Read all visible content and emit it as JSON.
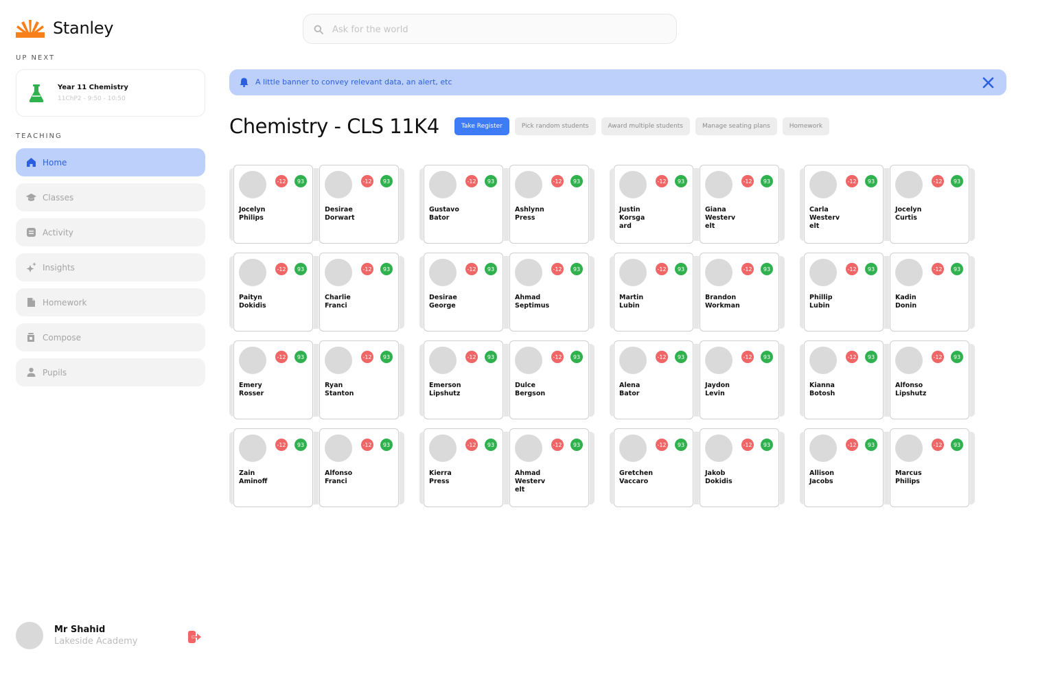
{
  "brand": {
    "name": "Stanley",
    "accent": "#f7801b"
  },
  "sidebar": {
    "up_next_label": "UP NEXT",
    "up_next": {
      "title": "Year 11 Chemistry",
      "subtitle": "11ChP2 - 9:50 - 10:50",
      "icon": "flask-icon"
    },
    "teaching_label": "TEACHING",
    "items": [
      {
        "label": "Home",
        "icon": "home-icon",
        "active": true
      },
      {
        "label": "Classes",
        "icon": "graduation-cap-icon",
        "active": false
      },
      {
        "label": "Activity",
        "icon": "list-icon",
        "active": false
      },
      {
        "label": "Insights",
        "icon": "sparkles-icon",
        "active": false
      },
      {
        "label": "Homework",
        "icon": "document-icon",
        "active": false
      },
      {
        "label": "Compose",
        "icon": "mug-icon",
        "active": false
      },
      {
        "label": "Pupils",
        "icon": "person-icon",
        "active": false
      }
    ],
    "profile": {
      "name": "Mr Shahid",
      "school": "Lakeside Academy"
    }
  },
  "search": {
    "placeholder": "Ask for the world",
    "value": ""
  },
  "banner": {
    "text": "A little banner to convey relevant data, an alert, etc"
  },
  "page": {
    "title": "Chemistry - CLS 11K4",
    "actions": {
      "take_register": "Take Register",
      "pick_random": "Pick random students",
      "award_multiple": "Award multiple students",
      "manage_seating": "Manage seating plans",
      "homework": "Homework"
    }
  },
  "colors": {
    "primary": "#3e7bf6",
    "banner_bg": "#bcd0fb",
    "negative": "#f06565",
    "positive": "#2fb14d"
  },
  "students": [
    {
      "name": "Jocelyn\nPhilips",
      "neg": "-12",
      "pos": "93"
    },
    {
      "name": "Desirae\nDorwart",
      "neg": "-12",
      "pos": "93"
    },
    {
      "name": "Gustavo\nBator",
      "neg": "-12",
      "pos": "93"
    },
    {
      "name": "Ashlynn\nPress",
      "neg": "-12",
      "pos": "93"
    },
    {
      "name": "Justin\nKorsga\nard",
      "neg": "-12",
      "pos": "93"
    },
    {
      "name": "Giana\nWesterv\nelt",
      "neg": "-12",
      "pos": "93"
    },
    {
      "name": "Carla\nWesterv\nelt",
      "neg": "-12",
      "pos": "93"
    },
    {
      "name": "Jocelyn\nCurtis",
      "neg": "-12",
      "pos": "93"
    },
    {
      "name": "Paityn\nDokidis",
      "neg": "-12",
      "pos": "93"
    },
    {
      "name": "Charlie\nFranci",
      "neg": "-12",
      "pos": "93"
    },
    {
      "name": "Desirae\nGeorge",
      "neg": "-12",
      "pos": "93"
    },
    {
      "name": "Ahmad\nSeptimus",
      "neg": "-12",
      "pos": "93"
    },
    {
      "name": "Martin\nLubin",
      "neg": "-12",
      "pos": "93"
    },
    {
      "name": "Brandon\nWorkman",
      "neg": "-12",
      "pos": "93"
    },
    {
      "name": "Phillip\nLubin",
      "neg": "-12",
      "pos": "93"
    },
    {
      "name": "Kadin\nDonin",
      "neg": "-12",
      "pos": "93"
    },
    {
      "name": "Emery\nRosser",
      "neg": "-12",
      "pos": "93"
    },
    {
      "name": "Ryan\nStanton",
      "neg": "-12",
      "pos": "93"
    },
    {
      "name": "Emerson\nLipshutz",
      "neg": "-12",
      "pos": "93"
    },
    {
      "name": "Dulce\nBergson",
      "neg": "-12",
      "pos": "93"
    },
    {
      "name": "Alena\nBator",
      "neg": "-12",
      "pos": "93"
    },
    {
      "name": "Jaydon\nLevin",
      "neg": "-12",
      "pos": "93"
    },
    {
      "name": "Kianna\nBotosh",
      "neg": "-12",
      "pos": "93"
    },
    {
      "name": "Alfonso\nLipshutz",
      "neg": "-12",
      "pos": "93"
    },
    {
      "name": "Zain\nAminoff",
      "neg": "-12",
      "pos": "93"
    },
    {
      "name": "Alfonso\nFranci",
      "neg": "-12",
      "pos": "93"
    },
    {
      "name": "Kierra\nPress",
      "neg": "-12",
      "pos": "93"
    },
    {
      "name": "Ahmad\nWesterv\nelt",
      "neg": "-12",
      "pos": "93"
    },
    {
      "name": "Gretchen\nVaccaro",
      "neg": "-12",
      "pos": "93"
    },
    {
      "name": "Jakob\nDokidis",
      "neg": "-12",
      "pos": "93"
    },
    {
      "name": "Allison\nJacobs",
      "neg": "-12",
      "pos": "93"
    },
    {
      "name": "Marcus\nPhilips",
      "neg": "-12",
      "pos": "93"
    }
  ]
}
